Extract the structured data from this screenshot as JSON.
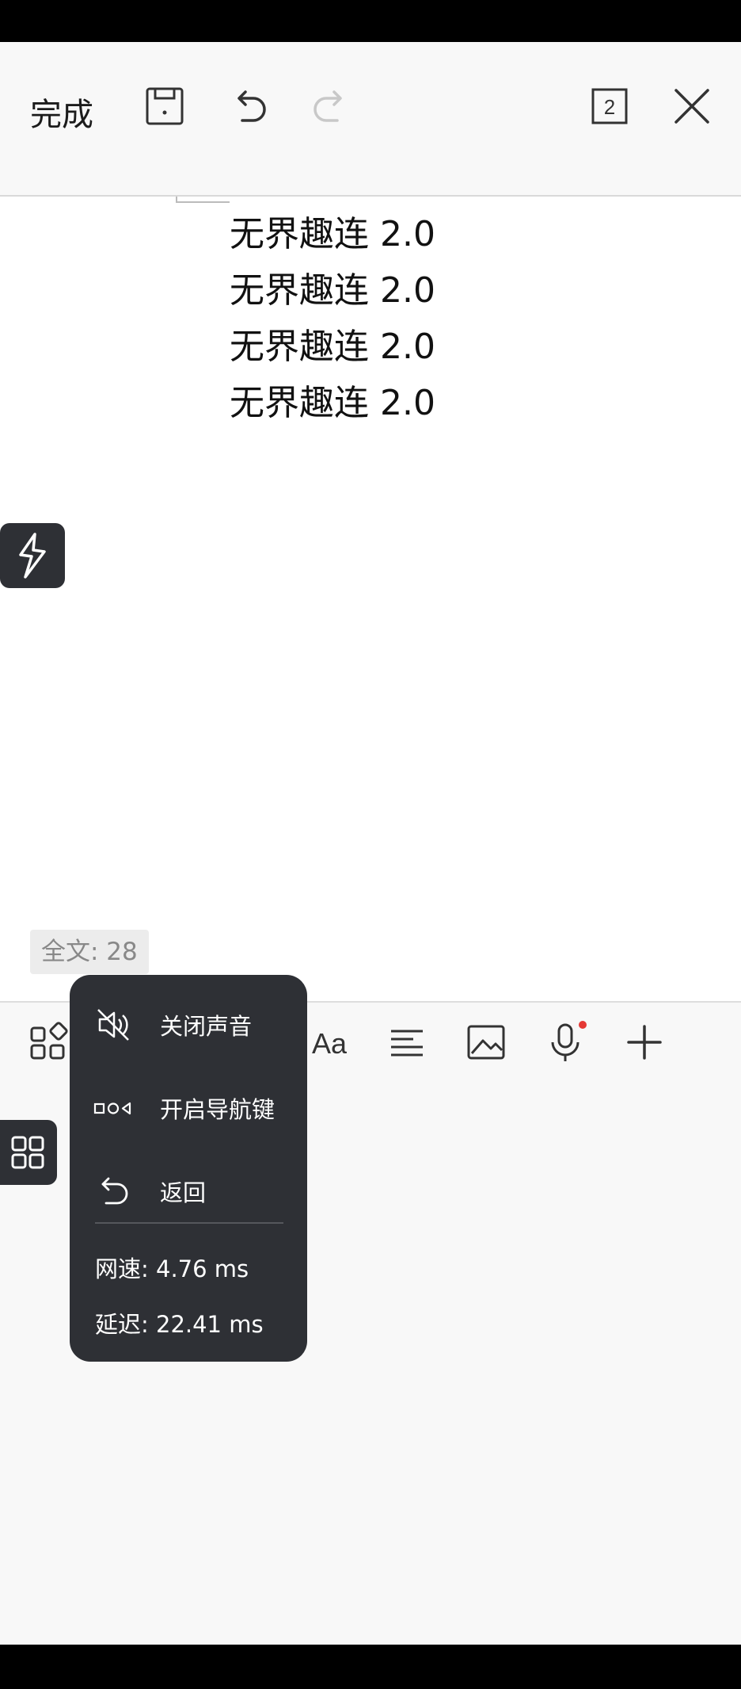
{
  "toolbar": {
    "done_label": "完成",
    "save_icon": "save-icon",
    "undo_icon": "undo-icon",
    "redo_icon": "redo-icon",
    "page_count": "2",
    "close_icon": "close-icon"
  },
  "document": {
    "lines": [
      "无界趣连 2.0",
      "无界趣连 2.0",
      "无界趣连 2.0",
      "无界趣连 2.0"
    ],
    "word_count": "全文: 28"
  },
  "bottom_toolbar": {
    "icons": [
      "apps-icon",
      "keyboard-icon",
      "phone-icon",
      "font-icon",
      "align-icon",
      "image-icon",
      "microphone-icon",
      "plus-icon"
    ],
    "font_label": "Aa",
    "mic_badge_color": "#e53935"
  },
  "popup": {
    "items": [
      {
        "label": "关闭声音",
        "icon": "mute-icon"
      },
      {
        "label": "开启导航键",
        "icon": "nav-keys-icon"
      },
      {
        "label": "返回",
        "icon": "back-icon"
      }
    ],
    "network_speed": "网速: 4.76 ms",
    "latency": "延迟: 22.41 ms"
  },
  "colors": {
    "popup_bg": "#2e3035",
    "background": "#f8f8f8",
    "document_bg": "#ffffff"
  }
}
